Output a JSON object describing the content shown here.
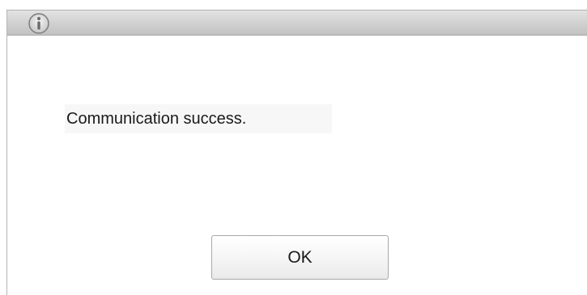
{
  "dialog": {
    "icon": "info-icon",
    "message": "Communication success.",
    "ok_label": "OK"
  },
  "colors": {
    "titlebar": "#d0d0d0",
    "background": "#ffffff",
    "button_border": "#a9a9a9"
  }
}
